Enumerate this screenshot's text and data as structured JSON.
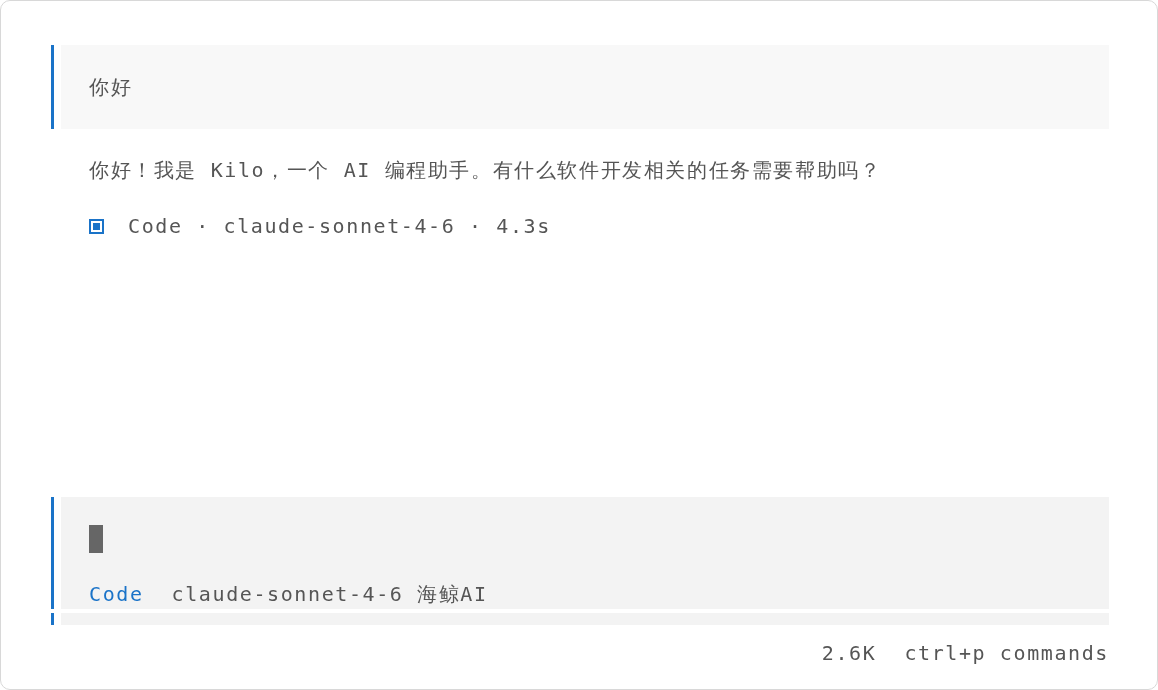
{
  "conversation": [
    {
      "kind": "user",
      "text": "你好"
    },
    {
      "kind": "assistant",
      "text": "你好！我是 Kilo，一个 AI 编程助手。有什么软件开发相关的任务需要帮助吗？",
      "meta": "Code · claude-sonnet-4-6 · 4.3s"
    }
  ],
  "prompt": {
    "mode": "Code",
    "model": "claude-sonnet-4-6",
    "provider": "海鲸AI"
  },
  "status_bar": {
    "tokens": "2.6K",
    "hint": "ctrl+p commands"
  }
}
